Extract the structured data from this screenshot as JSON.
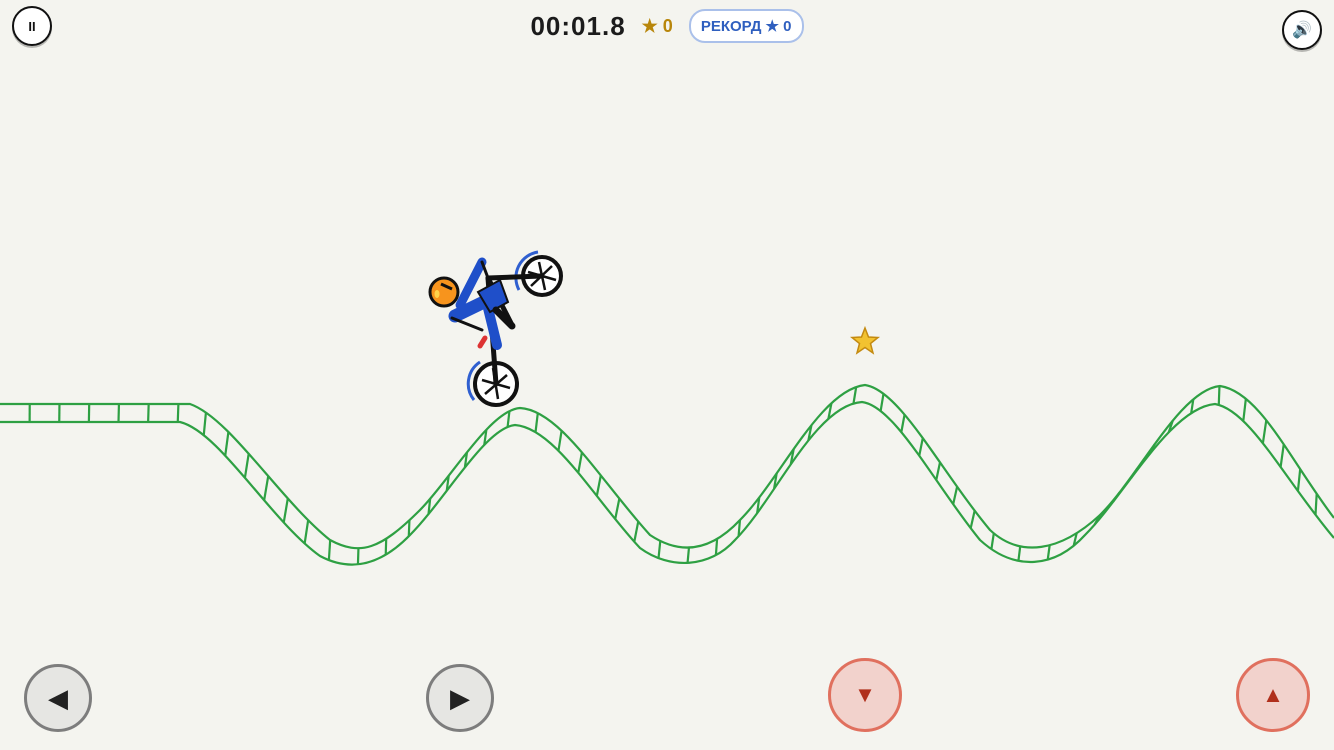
{
  "hud": {
    "timer": "00:01.8",
    "stars_text": "★ 0",
    "record_text": "РЕКОРД ★ 0"
  },
  "buttons": {
    "pause": "II",
    "sound": "🔊",
    "left": "◀",
    "right": "▶",
    "down": "▼",
    "up": "▲"
  },
  "colors": {
    "background": "#f4f4ef",
    "track": "#2ea043",
    "rider_suit": "#1f4fc9",
    "helmet": "#f7941d",
    "star": "#f2c230"
  },
  "icons": {
    "pause": "pause-icon",
    "sound": "speaker-icon",
    "collectible": "star-icon"
  }
}
